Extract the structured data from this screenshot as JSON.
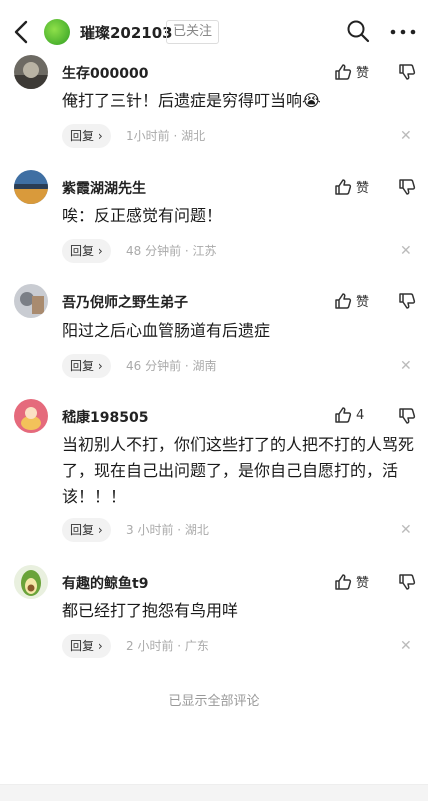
{
  "header": {
    "account_name": "璀璨202103",
    "follow_status": "已关注",
    "avatar_color": "#4cbb2f"
  },
  "comments": [
    {
      "user": "生存000000",
      "text": "俺打了三针！后遗症是穷得叮当响😭",
      "likes": "赞",
      "reply_label": "回复",
      "time": "1小时前",
      "location": "湖北"
    },
    {
      "user": "紫霞湖湖先生",
      "text": "唉：反正感觉有问题！",
      "likes": "赞",
      "reply_label": "回复",
      "time": "48 分钟前",
      "location": "江苏"
    },
    {
      "user": "吾乃倪师之野生弟子",
      "text": "阳过之后心血管肠道有后遗症",
      "likes": "赞",
      "reply_label": "回复",
      "time": "46 分钟前",
      "location": "湖南"
    },
    {
      "user": "嵇康198505",
      "text": "当初别人不打，你们这些打了的人把不打的人骂死了，现在自己出问题了，是你自己自愿打的，活该！！！",
      "likes": "4",
      "reply_label": "回复",
      "time": "3 小时前",
      "location": "湖北"
    },
    {
      "user": "有趣的鲸鱼t9",
      "text": "都已经打了抱怨有鸟用咩",
      "likes": "赞",
      "reply_label": "回复",
      "time": "2 小时前",
      "location": "广东"
    }
  ],
  "footer": {
    "all_shown": "已显示全部评论"
  }
}
